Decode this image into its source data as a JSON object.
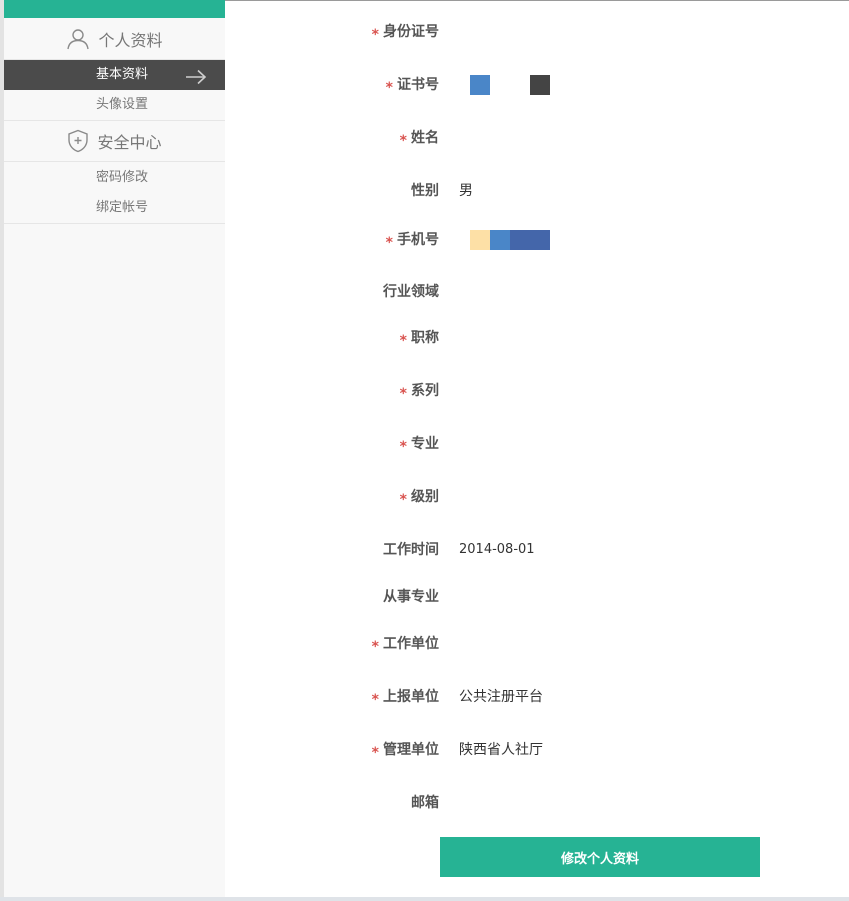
{
  "sidebar": {
    "profile_title": "个人资料",
    "profile_items": [
      {
        "label": "基本资料",
        "active": true
      },
      {
        "label": "头像设置",
        "active": false
      }
    ],
    "security_title": "安全中心",
    "security_items": [
      {
        "label": "密码修改"
      },
      {
        "label": "绑定帐号"
      }
    ]
  },
  "form": {
    "required_mark": "*",
    "fields": [
      {
        "label": "身份证号",
        "required": true,
        "value": ""
      },
      {
        "label": "证书号",
        "required": true,
        "value": ""
      },
      {
        "label": "姓名",
        "required": true,
        "value": ""
      },
      {
        "label": "性别",
        "required": false,
        "value": "男"
      },
      {
        "label": "手机号",
        "required": true,
        "value": ""
      },
      {
        "label": "行业领域",
        "required": false,
        "value": ""
      },
      {
        "label": "职称",
        "required": true,
        "value": ""
      },
      {
        "label": "系列",
        "required": true,
        "value": ""
      },
      {
        "label": "专业",
        "required": true,
        "value": ""
      },
      {
        "label": "级别",
        "required": true,
        "value": ""
      },
      {
        "label": "工作时间",
        "required": false,
        "value": "2014-08-01"
      },
      {
        "label": "从事专业",
        "required": false,
        "value": ""
      },
      {
        "label": "工作单位",
        "required": true,
        "value": ""
      },
      {
        "label": "上报单位",
        "required": true,
        "value": "公共注册平台"
      },
      {
        "label": "管理单位",
        "required": true,
        "value": "陕西省人社厅"
      },
      {
        "label": "邮箱",
        "required": false,
        "value": ""
      }
    ],
    "redactions": {
      "cert_colors": [
        "#4a86c8",
        "#ffffff",
        "#ffffff",
        "#444444"
      ],
      "phone_colors": [
        "#fde0a6",
        "#4a86c8",
        "#4466aa",
        "#4466aa"
      ]
    },
    "submit_label": "修改个人资料"
  },
  "colors": {
    "accent": "#26b394",
    "active_nav_bg": "#4b4b4b",
    "required": "#d9534f"
  }
}
